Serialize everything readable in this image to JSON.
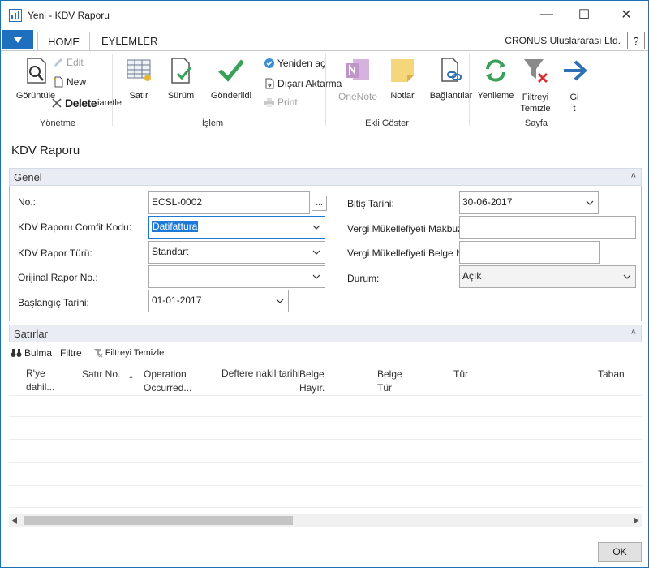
{
  "window": {
    "title": "Yeni - KDV Raporu",
    "minimize": "—",
    "maximize": "☐",
    "close": "✕"
  },
  "ribbon": {
    "tabs": [
      "HOME",
      "EYLEMLER"
    ],
    "company": "CRONUS Uluslararası Ltd.",
    "help": "?",
    "groups": {
      "yonetme": "Yönetme",
      "islem": "İşlem",
      "ekli_goster": "Ekli Göster",
      "sayfa": "Sayfa"
    },
    "buttons": {
      "goruntule": "Görüntüle",
      "edit": "Edit",
      "new": "New",
      "delete": "Delete",
      "delete_suffix": "iaretle",
      "satir": "Satır",
      "surum": "Sürüm",
      "gonderildi": "Gönderildi",
      "yeniden_ac": "Yeniden aç",
      "disari_aktarma": "Dışarı Aktarma",
      "print": "Print",
      "onenote": "OneNote",
      "notlar": "Notlar",
      "baglantilar": "Bağlantılar",
      "yenileme": "Yenileme",
      "filtreyi_temizle_1": "Filtreyi",
      "filtreyi_temizle_2": "Temizle",
      "git_1": "Gi",
      "git_2": "t"
    }
  },
  "page": {
    "title": "KDV Raporu"
  },
  "general": {
    "tab_label": "Genel",
    "collapse": "˄",
    "fields": {
      "no_label": "No.:",
      "no_value": "ECSL-0002",
      "assist": "...",
      "comfit_label": "KDV Raporu Comfit Kodu:",
      "comfit_value": "Datifattura",
      "rapor_turu_label": "KDV Rapor Türü:",
      "rapor_turu_value": "Standart",
      "orijinal_label": "Orijinal Rapor No.:",
      "orijinal_value": "",
      "baslangic_label": "Başlangıç Tarihi:",
      "baslangic_value": "01-01-2017",
      "bitis_label": "Bitiş Tarihi:",
      "bitis_value": "30-06-2017",
      "makbuz_label": "Vergi Mükellefiyeti Makbuz No.:",
      "makbuz_value": "",
      "belge_label": "Vergi Mükellefiyeti Belge No.:",
      "belge_value": "",
      "durum_label": "Durum:",
      "durum_value": "Açık"
    }
  },
  "lines": {
    "tab_label": "Satırlar",
    "collapse": "˄",
    "toolbar": {
      "bulma": "Bulma",
      "filtre": "Filtre",
      "filtreyi_temizle": "Filtreyi Temizle"
    },
    "columns": {
      "rye_1": "R'ye",
      "rye_2": "dahil...",
      "satir_no": "Satır No.",
      "operation_1": "Operation",
      "operation_2": "Occurred...",
      "deftere": "Deftere nakil tarihi",
      "belge_hayir_1": "Belge",
      "belge_hayir_2": "Hayır.",
      "belge_tur_1": "Belge",
      "belge_tur_2": "Tür",
      "tur": "Tür",
      "taban": "Taban"
    },
    "sort_indicator": "▲"
  },
  "footer": {
    "ok": "OK"
  },
  "colors": {
    "accent": "#1f6fbf",
    "fasttab_bg": "#e9ecf2",
    "selection": "#1c7ad6",
    "green_check": "#3aa05a",
    "arrow_blue": "#2f6fb5"
  }
}
